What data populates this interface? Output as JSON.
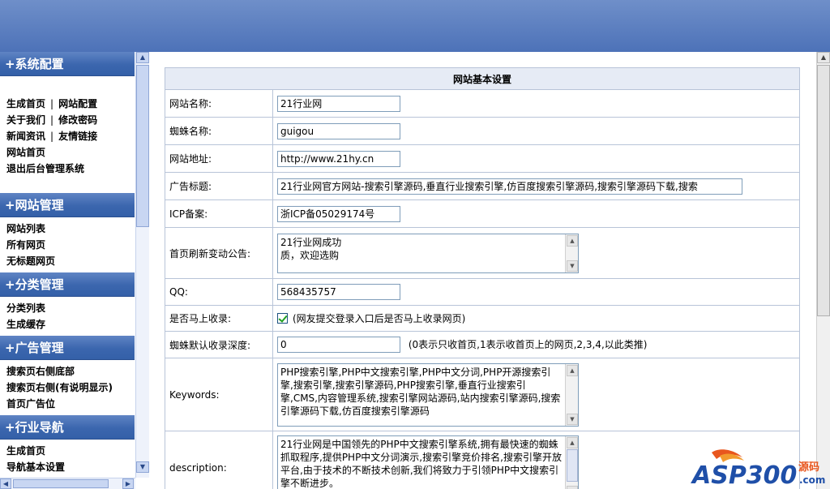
{
  "sidebar": {
    "sections": [
      {
        "title": "+系统配置",
        "rows": [
          [
            "生成首页",
            "网站配置"
          ],
          [
            "关于我们",
            "修改密码"
          ],
          [
            "新闻资讯",
            "友情链接"
          ],
          [
            "网站首页"
          ],
          [
            "退出后台管理系统"
          ]
        ]
      },
      {
        "title": "+网站管理",
        "rows": [
          [
            "网站列表"
          ],
          [
            "所有网页"
          ],
          [
            "无标题网页"
          ]
        ]
      },
      {
        "title": "+分类管理",
        "rows": [
          [
            "分类列表"
          ],
          [
            "生成缓存"
          ]
        ]
      },
      {
        "title": "+广告管理",
        "rows": [
          [
            "搜索页右侧底部"
          ],
          [
            "搜索页右侧(有说明显示)"
          ],
          [
            "首页广告位"
          ]
        ]
      },
      {
        "title": "+行业导航",
        "rows": [
          [
            "生成首页"
          ],
          [
            "导航基本设置"
          ]
        ]
      }
    ],
    "separator": "|"
  },
  "form": {
    "heading": "网站基本设置",
    "site_name_label": "网站名称:",
    "site_name_value": "21行业网",
    "spider_name_label": "蜘蛛名称:",
    "spider_name_value": "guigou",
    "site_url_label": "网站地址:",
    "site_url_value": "http://www.21hy.cn",
    "ad_title_label": "广告标题:",
    "ad_title_value": "21行业网官方网站-搜索引擎源码,垂直行业搜索引擎,仿百度搜索引擎源码,搜索引擎源码下载,搜索",
    "icp_label": "ICP备案:",
    "icp_value": "浙ICP备05029174号",
    "notice_label": "首页刷新变动公告:",
    "notice_value": "21行业网成功\n质，欢迎选购",
    "qq_label": "QQ:",
    "qq_value": "568435757",
    "auto_include_label": "是否马上收录:",
    "auto_include_checked": true,
    "auto_include_note": "(网友提交登录入口后是否马上收录网页)",
    "depth_label": "蜘蛛默认收录深度:",
    "depth_value": "0",
    "depth_note": "(0表示只收首页,1表示收首页上的网页,2,3,4,以此类推)",
    "keywords_label": "Keywords:",
    "keywords_value": "PHP搜索引擎,PHP中文搜索引擎,PHP中文分词,PHP开源搜索引擎,搜索引擎,搜索引擎源码,PHP搜索引擎,垂直行业搜索引擎,CMS,内容管理系统,搜索引擎网站源码,站内搜索引擎源码,搜索引擎源码下载,仿百度搜索引擎源码",
    "description_label": "description:",
    "description_value": "21行业网是中国领先的PHP中文搜索引擎系统,拥有最快速的蜘蛛抓取程序,提供PHP中文分词演示,搜索引擎竞价排名,搜索引擎开放平台,由于技术的不断技术创新,我们将致力于引领PHP中文搜索引擎不断进步。"
  },
  "watermark": {
    "brand": "ASP300",
    "suffix": "源码",
    "domain": ".com",
    "color_primary": "#1f4fa8",
    "color_flame": "#e8561e"
  }
}
